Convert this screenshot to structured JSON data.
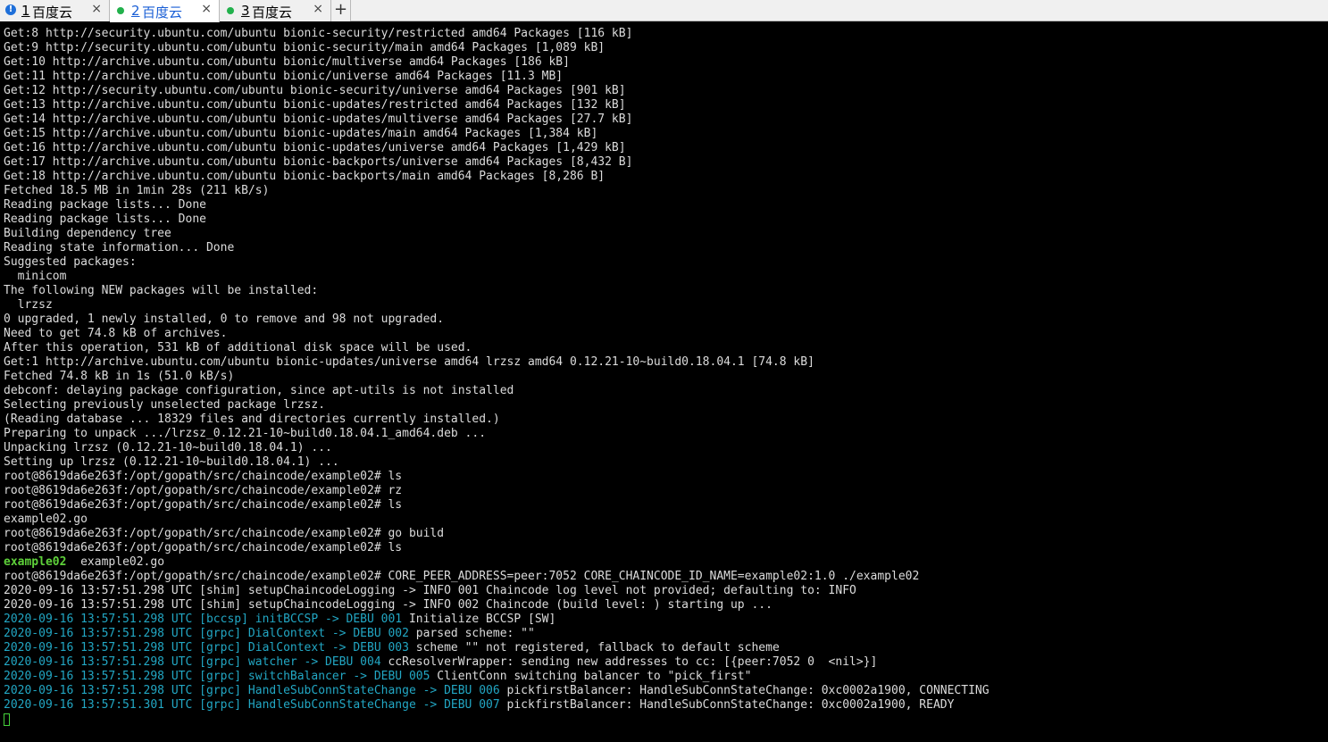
{
  "tabs": [
    {
      "number": "1",
      "label": "百度云",
      "status_icon": "info-icon",
      "active": false
    },
    {
      "number": "2",
      "label": "百度云",
      "status_icon": "connected-dot-icon",
      "active": true
    },
    {
      "number": "3",
      "label": "百度云",
      "status_icon": "connected-dot-icon",
      "active": false
    }
  ],
  "add_tab_label": "+",
  "close_glyph": "×",
  "colors": {
    "cyan": "#22a7c4",
    "green": "#5ed13a",
    "text": "#dcdcdc",
    "background": "#000000"
  },
  "terminal": {
    "lines": [
      [
        {
          "t": "Get:8 http://security.ubuntu.com/ubuntu bionic-security/restricted amd64 Packages [116 kB]"
        }
      ],
      [
        {
          "t": "Get:9 http://security.ubuntu.com/ubuntu bionic-security/main amd64 Packages [1,089 kB]"
        }
      ],
      [
        {
          "t": "Get:10 http://archive.ubuntu.com/ubuntu bionic/multiverse amd64 Packages [186 kB]"
        }
      ],
      [
        {
          "t": "Get:11 http://archive.ubuntu.com/ubuntu bionic/universe amd64 Packages [11.3 MB]"
        }
      ],
      [
        {
          "t": "Get:12 http://security.ubuntu.com/ubuntu bionic-security/universe amd64 Packages [901 kB]"
        }
      ],
      [
        {
          "t": "Get:13 http://archive.ubuntu.com/ubuntu bionic-updates/restricted amd64 Packages [132 kB]"
        }
      ],
      [
        {
          "t": "Get:14 http://archive.ubuntu.com/ubuntu bionic-updates/multiverse amd64 Packages [27.7 kB]"
        }
      ],
      [
        {
          "t": "Get:15 http://archive.ubuntu.com/ubuntu bionic-updates/main amd64 Packages [1,384 kB]"
        }
      ],
      [
        {
          "t": "Get:16 http://archive.ubuntu.com/ubuntu bionic-updates/universe amd64 Packages [1,429 kB]"
        }
      ],
      [
        {
          "t": "Get:17 http://archive.ubuntu.com/ubuntu bionic-backports/universe amd64 Packages [8,432 B]"
        }
      ],
      [
        {
          "t": "Get:18 http://archive.ubuntu.com/ubuntu bionic-backports/main amd64 Packages [8,286 B]"
        }
      ],
      [
        {
          "t": "Fetched 18.5 MB in 1min 28s (211 kB/s)"
        }
      ],
      [
        {
          "t": "Reading package lists... Done"
        }
      ],
      [
        {
          "t": "Reading package lists... Done"
        }
      ],
      [
        {
          "t": "Building dependency tree"
        }
      ],
      [
        {
          "t": "Reading state information... Done"
        }
      ],
      [
        {
          "t": "Suggested packages:"
        }
      ],
      [
        {
          "t": "  minicom"
        }
      ],
      [
        {
          "t": "The following NEW packages will be installed:"
        }
      ],
      [
        {
          "t": "  lrzsz"
        }
      ],
      [
        {
          "t": "0 upgraded, 1 newly installed, 0 to remove and 98 not upgraded."
        }
      ],
      [
        {
          "t": "Need to get 74.8 kB of archives."
        }
      ],
      [
        {
          "t": "After this operation, 531 kB of additional disk space will be used."
        }
      ],
      [
        {
          "t": "Get:1 http://archive.ubuntu.com/ubuntu bionic-updates/universe amd64 lrzsz amd64 0.12.21-10~build0.18.04.1 [74.8 kB]"
        }
      ],
      [
        {
          "t": "Fetched 74.8 kB in 1s (51.0 kB/s)"
        }
      ],
      [
        {
          "t": "debconf: delaying package configuration, since apt-utils is not installed"
        }
      ],
      [
        {
          "t": "Selecting previously unselected package lrzsz."
        }
      ],
      [
        {
          "t": "(Reading database ... 18329 files and directories currently installed.)"
        }
      ],
      [
        {
          "t": "Preparing to unpack .../lrzsz_0.12.21-10~build0.18.04.1_amd64.deb ..."
        }
      ],
      [
        {
          "t": "Unpacking lrzsz (0.12.21-10~build0.18.04.1) ..."
        }
      ],
      [
        {
          "t": "Setting up lrzsz (0.12.21-10~build0.18.04.1) ..."
        }
      ],
      [
        {
          "t": "root@8619da6e263f:/opt/gopath/src/chaincode/example02# ls"
        }
      ],
      [
        {
          "t": "root@8619da6e263f:/opt/gopath/src/chaincode/example02# rz"
        }
      ],
      [
        {
          "t": "root@8619da6e263f:/opt/gopath/src/chaincode/example02# ls"
        }
      ],
      [
        {
          "t": "example02.go"
        }
      ],
      [
        {
          "t": "root@8619da6e263f:/opt/gopath/src/chaincode/example02# go build"
        }
      ],
      [
        {
          "t": "root@8619da6e263f:/opt/gopath/src/chaincode/example02# ls"
        }
      ],
      [
        {
          "t": "example02",
          "c": "green"
        },
        {
          "t": "  example02.go"
        }
      ],
      [
        {
          "t": "root@8619da6e263f:/opt/gopath/src/chaincode/example02# CORE_PEER_ADDRESS=peer:7052 CORE_CHAINCODE_ID_NAME=example02:1.0 ./example02"
        }
      ],
      [
        {
          "t": "2020-09-16 13:57:51.298 UTC [shim] setupChaincodeLogging -> INFO 001 Chaincode log level not provided; defaulting to: INFO"
        }
      ],
      [
        {
          "t": "2020-09-16 13:57:51.298 UTC [shim] setupChaincodeLogging -> INFO 002 Chaincode (build level: ) starting up ..."
        }
      ],
      [
        {
          "t": "2020-09-16 13:57:51.298 UTC [bccsp] initBCCSP -> DEBU 001",
          "c": "cyan"
        },
        {
          "t": " Initialize BCCSP [SW]"
        }
      ],
      [
        {
          "t": "2020-09-16 13:57:51.298 UTC [grpc] DialContext -> DEBU 002",
          "c": "cyan"
        },
        {
          "t": " parsed scheme: \"\""
        }
      ],
      [
        {
          "t": "2020-09-16 13:57:51.298 UTC [grpc] DialContext -> DEBU 003",
          "c": "cyan"
        },
        {
          "t": " scheme \"\" not registered, fallback to default scheme"
        }
      ],
      [
        {
          "t": "2020-09-16 13:57:51.298 UTC [grpc] watcher -> DEBU 004",
          "c": "cyan"
        },
        {
          "t": " ccResolverWrapper: sending new addresses to cc: [{peer:7052 0  <nil>}]"
        }
      ],
      [
        {
          "t": "2020-09-16 13:57:51.298 UTC [grpc] switchBalancer -> DEBU 005",
          "c": "cyan"
        },
        {
          "t": " ClientConn switching balancer to \"pick_first\""
        }
      ],
      [
        {
          "t": "2020-09-16 13:57:51.298 UTC [grpc] HandleSubConnStateChange -> DEBU 006",
          "c": "cyan"
        },
        {
          "t": " pickfirstBalancer: HandleSubConnStateChange: 0xc0002a1900, CONNECTING"
        }
      ],
      [
        {
          "t": "2020-09-16 13:57:51.301 UTC [grpc] HandleSubConnStateChange -> DEBU 007",
          "c": "cyan"
        },
        {
          "t": " pickfirstBalancer: HandleSubConnStateChange: 0xc0002a1900, READY"
        }
      ]
    ]
  }
}
